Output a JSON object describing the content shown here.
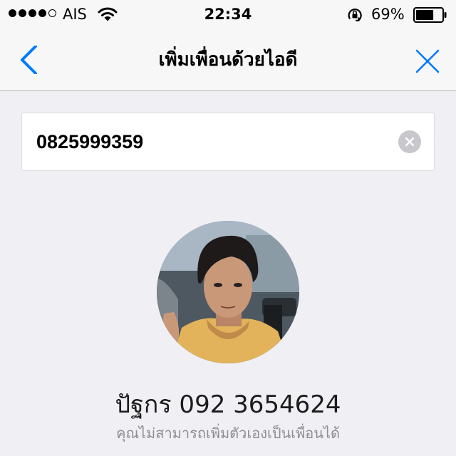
{
  "status_bar": {
    "carrier": "AIS",
    "signal_bars_filled": 4,
    "signal_bars_total": 5,
    "time": "22:34",
    "battery_percent": "69%",
    "battery_level": 0.69
  },
  "nav": {
    "title": "เพิ่มเพื่อนด้วยไอดี",
    "back_icon": "chevron-left-icon",
    "close_icon": "close-icon"
  },
  "search": {
    "value": "0825999359",
    "clear_icon": "clear-circle-icon"
  },
  "result": {
    "name": "ปัฐกร 092 3654624",
    "note": "คุณไม่สามารถเพิ่มตัวเองเป็นเพื่อนได้"
  },
  "colors": {
    "accent": "#007aff",
    "background": "#efeff4",
    "bar_background": "#f7f7f7",
    "secondary_text": "#8e8e93",
    "clear_button": "#c7c7cc"
  }
}
